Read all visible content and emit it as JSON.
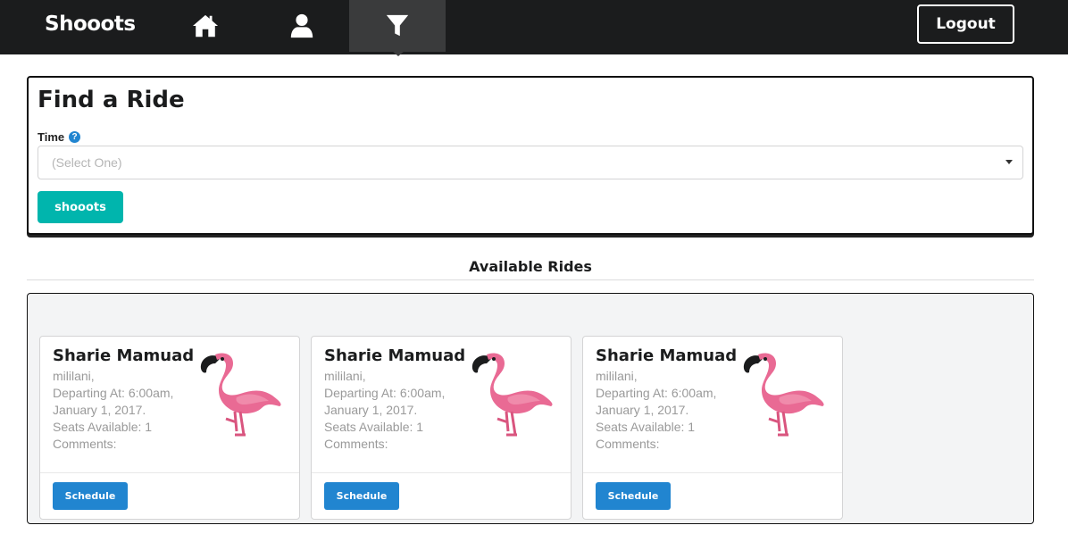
{
  "nav": {
    "brand": "Shooots",
    "items": [
      {
        "icon": "home-icon"
      },
      {
        "icon": "user-icon"
      },
      {
        "icon": "filter-icon",
        "active": true
      }
    ],
    "logout_label": "Logout"
  },
  "find": {
    "title": "Find a Ride",
    "time_label": "Time",
    "help_icon": "question-circle-icon",
    "select_placeholder": "(Select One)",
    "submit_label": "shooots"
  },
  "rides": {
    "section_title": "Available Rides",
    "items": [
      {
        "name": "Sharie Mamuad",
        "location": "mililani,",
        "departing_line1": "Departing At: 6:00am,",
        "departing_line2": "January 1, 2017.",
        "seats": "Seats Available: 1",
        "comments": "Comments:",
        "image": "flamingo",
        "button_label": "Schedule"
      },
      {
        "name": "Sharie Mamuad",
        "location": "mililani,",
        "departing_line1": "Departing At: 6:00am,",
        "departing_line2": "January 1, 2017.",
        "seats": "Seats Available: 1",
        "comments": "Comments:",
        "image": "flamingo",
        "button_label": "Schedule"
      },
      {
        "name": "Sharie Mamuad",
        "location": "mililani,",
        "departing_line1": "Departing At: 6:00am,",
        "departing_line2": "January 1, 2017.",
        "seats": "Seats Available: 1",
        "comments": "Comments:",
        "image": "flamingo",
        "button_label": "Schedule"
      }
    ]
  },
  "colors": {
    "nav_bg": "#1b1c1d",
    "nav_active": "#3a3b3c",
    "teal": "#00b5ad",
    "blue": "#2185d0",
    "panel_bg": "#f3f4f5"
  }
}
